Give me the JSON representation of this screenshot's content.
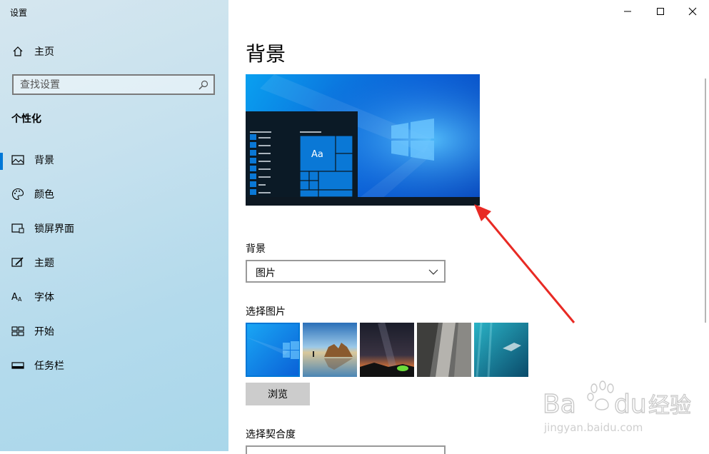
{
  "app": {
    "title": "设置"
  },
  "window": {
    "minimize": "minimize",
    "maximize": "maximize",
    "close": "close"
  },
  "sidebar": {
    "home_label": "主页",
    "search_placeholder": "查找设置",
    "section_title": "个性化",
    "items": [
      {
        "label": "背景",
        "icon": "picture-icon",
        "active": true
      },
      {
        "label": "颜色",
        "icon": "palette-icon"
      },
      {
        "label": "锁屏界面",
        "icon": "lock-screen-icon"
      },
      {
        "label": "主题",
        "icon": "theme-brush-icon"
      },
      {
        "label": "字体",
        "icon": "font-icon"
      },
      {
        "label": "开始",
        "icon": "start-grid-icon"
      },
      {
        "label": "任务栏",
        "icon": "taskbar-icon"
      }
    ]
  },
  "main": {
    "title": "背景",
    "preview": {
      "tile_text": "Aa"
    },
    "background_label": "背景",
    "background_value": "图片",
    "choose_picture_label": "选择图片",
    "browse_label": "浏览",
    "fit_label": "选择契合度"
  },
  "watermark": {
    "brand": "Baidu",
    "brand_cn": "经验",
    "url": "jingyan.baidu.com"
  },
  "colors": {
    "accent": "#0078d7",
    "arrow": "#e82a24"
  }
}
